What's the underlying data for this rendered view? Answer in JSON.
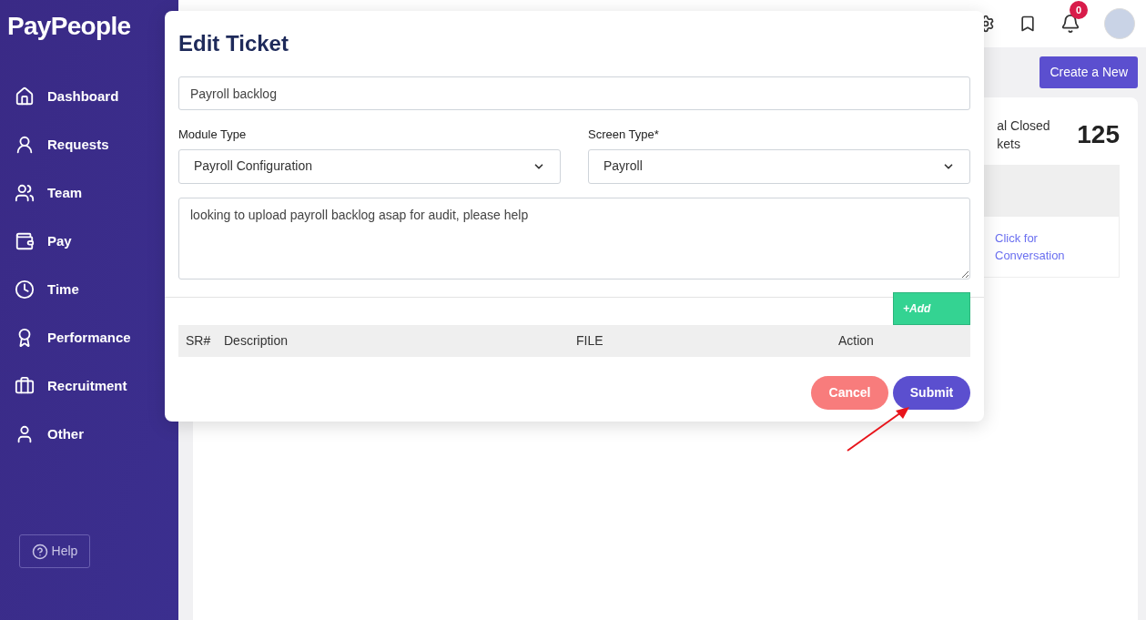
{
  "logo": "PayPeople",
  "sidebar": {
    "items": [
      {
        "label": "Dashboard"
      },
      {
        "label": "Requests"
      },
      {
        "label": "Team"
      },
      {
        "label": "Pay"
      },
      {
        "label": "Time"
      },
      {
        "label": "Performance"
      },
      {
        "label": "Recruitment"
      },
      {
        "label": "Other"
      }
    ],
    "help": "Help"
  },
  "header": {
    "notification_count": "0"
  },
  "page": {
    "create_button": "Create a New",
    "stat_label": "al Closed kets",
    "stat_value": "125",
    "link": "Click for Conversation"
  },
  "modal": {
    "title": "Edit Ticket",
    "subject": "Payroll backlog",
    "module_type": {
      "label": "Module Type",
      "value": "Payroll Configuration"
    },
    "screen_type": {
      "label": "Screen Type*",
      "value": "Payroll"
    },
    "description": "looking to upload payroll backlog asap for audit, please help",
    "add_button": "+Add",
    "columns": [
      "SR#",
      "Description",
      "FILE",
      "Action"
    ],
    "cancel": "Cancel",
    "submit": "Submit"
  }
}
